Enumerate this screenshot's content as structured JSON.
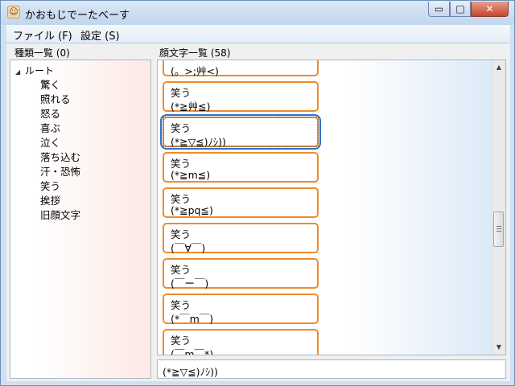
{
  "window": {
    "title": "かおもじでーたべーす",
    "icon": "app-face-icon",
    "buttons": {
      "minimize": "▭",
      "maximize": "□",
      "close": "✕"
    }
  },
  "menu": {
    "file": "ファイル (F)",
    "settings": "設定 (S)"
  },
  "categories": {
    "label": "種類一覧 (0)",
    "root": "ルート",
    "items": [
      "驚く",
      "照れる",
      "怒る",
      "喜ぶ",
      "泣く",
      "落ち込む",
      "汗・恐怖",
      "笑う",
      "挨拶",
      "旧顔文字"
    ]
  },
  "faces": {
    "label": "顔文字一覧 (58)",
    "cards": [
      {
        "category": "",
        "face": "(。>;艸<)"
      },
      {
        "category": "笑う",
        "face": "(*≧艸≦)"
      },
      {
        "category": "笑う",
        "face": "(*≧▽≦)ﾉｼ))",
        "selected": true
      },
      {
        "category": "笑う",
        "face": "(*≧m≦)"
      },
      {
        "category": "笑う",
        "face": "(*≧pq≦)"
      },
      {
        "category": "笑う",
        "face": "(￣∀￣)"
      },
      {
        "category": "笑う",
        "face": "(￣ー￣)"
      },
      {
        "category": "笑う",
        "face": "(*￣m￣)"
      },
      {
        "category": "笑う",
        "face": "(￣m￣*)"
      }
    ]
  },
  "selected_text": "(*≧▽≦)ﾉｼ))",
  "colors": {
    "card_border": "#f08a2c",
    "selection": "#2d73c9",
    "close_button": "#c7452c"
  }
}
